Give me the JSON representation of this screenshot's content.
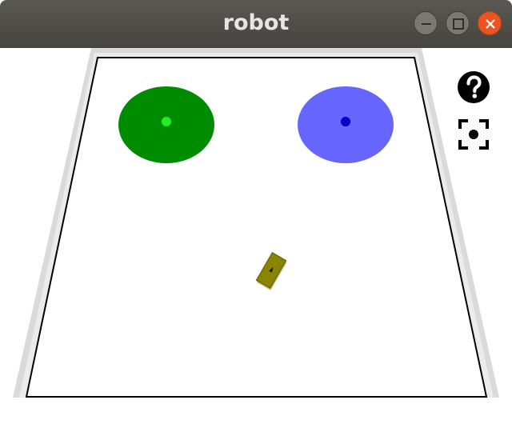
{
  "window": {
    "title": "robot"
  },
  "window_controls": {
    "minimize": "minimize-icon",
    "maximize": "maximize-icon",
    "close": "close-icon",
    "close_color": "#e95420"
  },
  "scene": {
    "goal_zones": [
      {
        "name": "green-zone",
        "fill": "#008c00",
        "marker": "#22ee22"
      },
      {
        "name": "blue-zone",
        "fill": "#6666ff",
        "marker": "#0000cc"
      }
    ],
    "robot": {
      "color": "#8a8400"
    }
  },
  "toolbar": {
    "help_icon": "question-circle-icon",
    "camera_icon": "focus-camera-icon"
  }
}
